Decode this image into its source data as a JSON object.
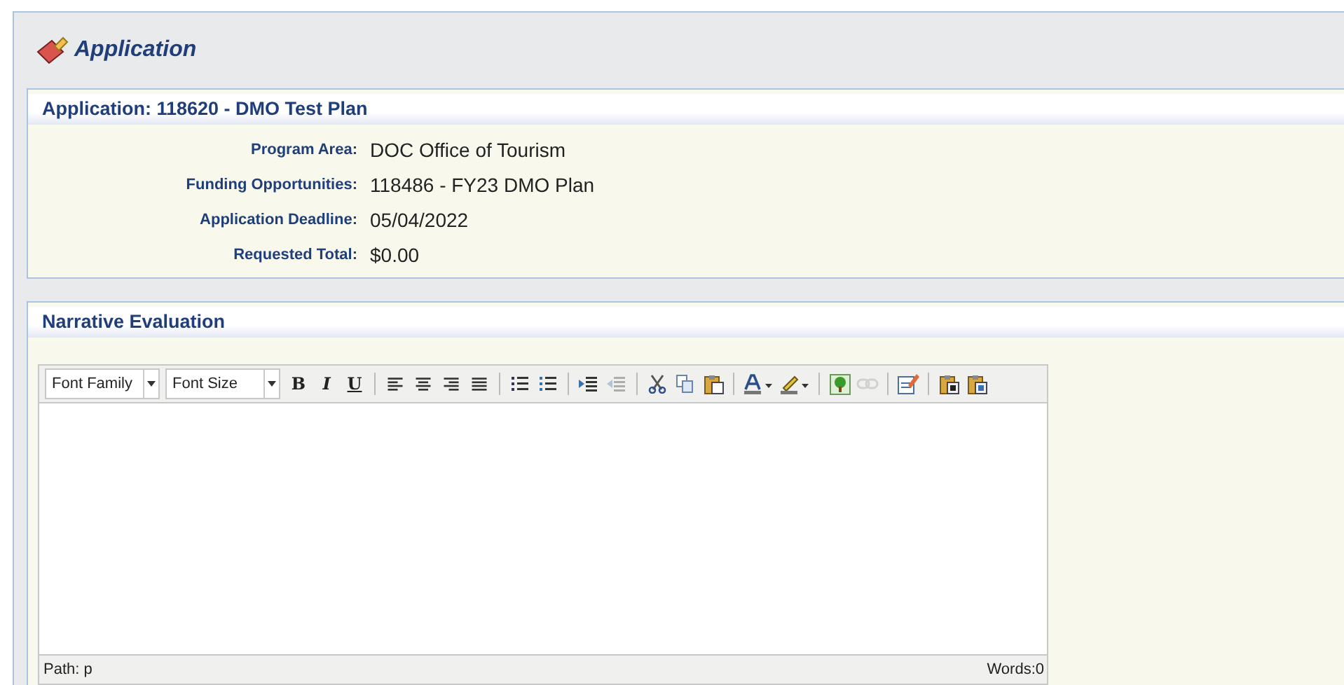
{
  "header": {
    "title": "Application"
  },
  "application": {
    "title": "Application: 118620 - DMO Test Plan",
    "fields": [
      {
        "label": "Program Area:",
        "value": "DOC Office of Tourism"
      },
      {
        "label": "Funding Opportunities:",
        "value": "118486 - FY23 DMO Plan"
      },
      {
        "label": "Application Deadline:",
        "value": "05/04/2022"
      },
      {
        "label": "Requested Total:",
        "value": "$0.00"
      }
    ]
  },
  "narrative": {
    "title": "Narrative Evaluation",
    "editor": {
      "selects": [
        {
          "value": "Font Family"
        },
        {
          "value": "Font Size"
        }
      ],
      "toolbar": [
        [
          {
            "kind": "bold",
            "glyph": "B",
            "disabled": false
          },
          {
            "kind": "italic",
            "glyph": "I",
            "disabled": false
          },
          {
            "kind": "underline",
            "glyph": "U",
            "disabled": false
          }
        ],
        [
          {
            "kind": "align-left",
            "disabled": false
          },
          {
            "kind": "align-center",
            "disabled": false
          },
          {
            "kind": "align-right",
            "disabled": false
          },
          {
            "kind": "justify",
            "disabled": false
          }
        ],
        [
          {
            "kind": "bullet-list",
            "disabled": false
          },
          {
            "kind": "number-list",
            "disabled": false
          }
        ],
        [
          {
            "kind": "indent",
            "disabled": false
          },
          {
            "kind": "outdent",
            "disabled": true
          }
        ],
        [
          {
            "kind": "cut",
            "disabled": false
          },
          {
            "kind": "copy",
            "disabled": false
          },
          {
            "kind": "paste",
            "disabled": false
          }
        ],
        [
          {
            "kind": "text-color",
            "disabled": false
          },
          {
            "kind": "highlight",
            "disabled": false
          }
        ],
        [
          {
            "kind": "image",
            "disabled": false
          },
          {
            "kind": "link",
            "disabled": true
          }
        ],
        [
          {
            "kind": "edit",
            "disabled": false
          }
        ],
        [
          {
            "kind": "paste-text",
            "disabled": false
          },
          {
            "kind": "paste-word",
            "disabled": false
          }
        ]
      ],
      "path": "Path: p",
      "words": "Words:0"
    }
  }
}
